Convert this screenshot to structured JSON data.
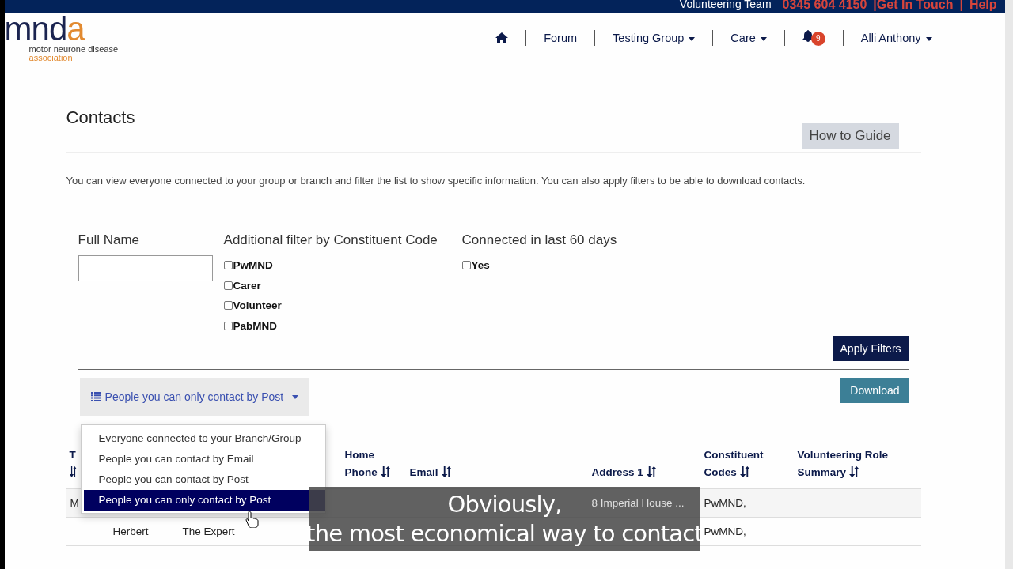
{
  "top_bar": {
    "team": "Volunteering Team",
    "phone": "0345 604 4150",
    "links": [
      "|Get In Touch",
      "|",
      "Help"
    ]
  },
  "logo": {
    "mark_main": "mnd",
    "mark_accent": "a",
    "line_1": "motor neurone disease",
    "line_2": "association"
  },
  "nav": [
    {
      "kind": "home"
    },
    {
      "kind": "link",
      "label": "Forum",
      "has_menu": false
    },
    {
      "kind": "link",
      "label": "Testing Group",
      "has_menu": true
    },
    {
      "kind": "link",
      "label": "Care",
      "has_menu": true
    },
    {
      "kind": "bell",
      "badge": "9"
    },
    {
      "kind": "link",
      "label": "Alli Anthony",
      "has_menu": true
    }
  ],
  "page": {
    "title": "Contacts",
    "guide_button": "How to Guide",
    "description": "You can view everyone connected to your group or branch and filter the list to show specific information. You can also apply filters to be able to download contacts."
  },
  "filters": {
    "full_name": {
      "label": "Full Name"
    },
    "constituent": {
      "label": "Additional filter by Constituent Code",
      "options": [
        {
          "label": "PwMND",
          "checked": false
        },
        {
          "label": "Carer",
          "checked": false
        },
        {
          "label": "Volunteer",
          "checked": false
        },
        {
          "label": "PabMND",
          "checked": false
        }
      ]
    },
    "connected": {
      "label": "Connected in last 60 days",
      "options": [
        {
          "label": "Yes",
          "checked": false
        }
      ]
    },
    "apply_button": "Apply Filters"
  },
  "view_dropdown": {
    "label": "People you can only contact by Post",
    "expanded": true,
    "items": [
      {
        "label": "Everyone connected to your Branch/Group",
        "selected": false
      },
      {
        "label": "People you can contact by Email",
        "selected": false
      },
      {
        "label": "People you can contact by Post",
        "selected": false
      },
      {
        "label": "People you can only contact by Post",
        "selected": true
      }
    ]
  },
  "download_button": "Download",
  "table": {
    "columns": [
      {
        "label": "T",
        "sortable": true
      },
      null,
      null,
      {
        "label": "Home Phone",
        "sortable": true
      },
      {
        "label": "Email",
        "sortable": true
      },
      {
        "label": "Address 1",
        "sortable": true
      },
      {
        "label": "Constituent Codes",
        "sortable": true
      },
      {
        "label": "Volunteering Role Summary",
        "sortable": true
      }
    ],
    "rows": [
      [
        "M",
        "",
        "",
        "",
        "",
        "8 Imperial House ...",
        "PwMND,",
        ""
      ],
      [
        "",
        "Herbert",
        "The Expert",
        "",
        "",
        "",
        "PwMND,",
        ""
      ]
    ]
  },
  "subtitle": [
    "Obviously,",
    "the most economical way to contact"
  ]
}
